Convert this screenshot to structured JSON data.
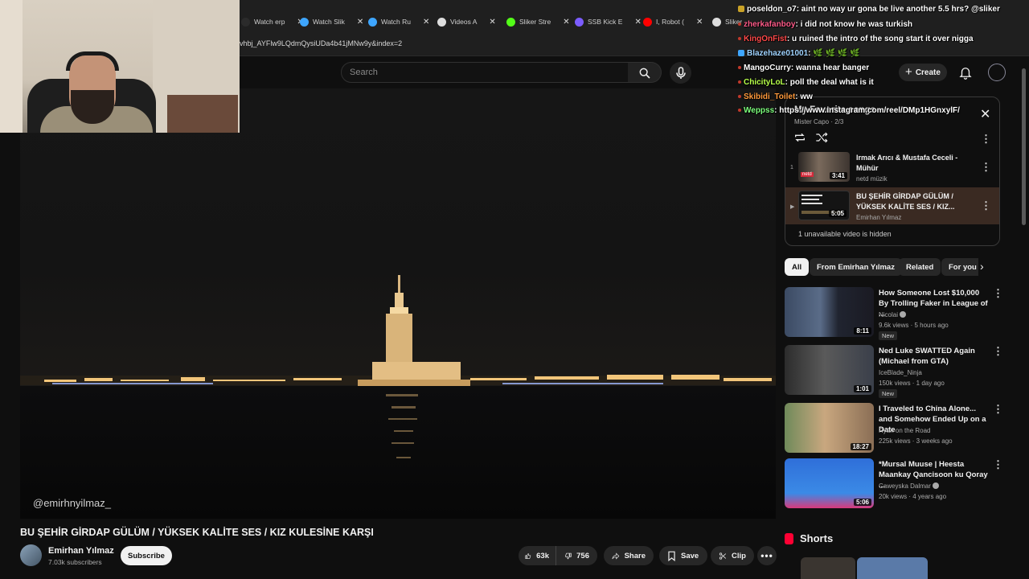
{
  "browser": {
    "tabs": [
      {
        "label": "Watch erp",
        "color": "#2b2b2b"
      },
      {
        "label": "Watch Slik",
        "color": "#3ea6ff"
      },
      {
        "label": "Watch Ru",
        "color": "#3ea6ff"
      },
      {
        "label": "Videos A",
        "color": "#dddddd"
      },
      {
        "label": "Sliker Stre",
        "color": "#53fc18"
      },
      {
        "label": "SSB Kick E",
        "color": "#7b5cff"
      },
      {
        "label": "I, Robot (",
        "color": "#ff0000"
      },
      {
        "label": "Sliker",
        "color": "#dddddd"
      }
    ],
    "url": "vhbj_AYFlw9LQdmQysiUDa4b41jMNw9y&index=2"
  },
  "search": {
    "placeholder": "Search"
  },
  "header": {
    "create_label": "Create"
  },
  "video": {
    "watermark": "@emirhnyilmaz_",
    "title": "BU ŞEHİR GİRDAP GÜLÜM / YÜKSEK KALİTE SES / KIZ KULESİNE KARŞI",
    "channel": "Emirhan Yılmaz",
    "subscribers": "7.03k subscribers",
    "subscribe_label": "Subscribe",
    "likes": "63k",
    "dislikes": "756",
    "share_label": "Share",
    "save_label": "Save",
    "clip_label": "Clip"
  },
  "playlist": {
    "title": "My Favorite songs",
    "subtitle": "Mister Capo · 2/3",
    "items": [
      {
        "index": "1",
        "title": "Irmak Arıcı & Mustafa Ceceli - Mühür",
        "channel": "netd müzik",
        "duration": "3:41"
      },
      {
        "index": "▶",
        "title": "BU ŞEHİR GİRDAP GÜLÜM / YÜKSEK KALİTE SES / KIZ...",
        "channel": "Emirhan Yılmaz",
        "duration": "5:05"
      }
    ],
    "hidden_note": "1 unavailable video is hidden"
  },
  "chips": [
    "All",
    "From Emirhan Yılmaz",
    "Related",
    "For you"
  ],
  "recommended": [
    {
      "title": "How Someone Lost $10,000 By Trolling Faker in League of ...",
      "channel": "Nicolai",
      "meta": "9.6k views · 5 hours ago",
      "badge": "New",
      "duration": "8:11"
    },
    {
      "title": "Ned Luke SWATTED Again (Michael from GTA)",
      "channel": "IceBlade_Ninja",
      "meta": "150k views · 1 day ago",
      "badge": "New",
      "duration": "1:01"
    },
    {
      "title": "I Traveled to China Alone... and Somehow Ended Up on a Date",
      "channel": "Ryan on the Road",
      "meta": "225k views · 3 weeks ago",
      "badge": "",
      "duration": "18:27"
    },
    {
      "title": "*Mursal Muuse | Heesta Maankay Qancisoon ku Qoray ...",
      "channel": "Caweyska Dalmar",
      "meta": "20k views · 4 years ago",
      "badge": "",
      "duration": "5:06"
    }
  ],
  "shorts_label": "Shorts",
  "chat": [
    {
      "user": "poseldon_o7",
      "color": "#ffffff",
      "badge": "#c9a227",
      "msg": ": aint no way ur gona be live another 5.5 hrs? @sliker"
    },
    {
      "user": "zherkafanboy",
      "color": "#ff5c8a",
      "badge": "",
      "msg": ": i did not know he was turkish"
    },
    {
      "user": "KingOnFist",
      "color": "#ff4a4a",
      "badge": "",
      "msg": ": u ruined the intro of the song start it over nigga"
    },
    {
      "user": "Blazehaze01001",
      "color": "#9fd3ff",
      "badge": "#3ea6ff",
      "msg": ": 🌿 🌿 🌿 🌿"
    },
    {
      "user": "MangoCurry",
      "color": "#ffffff",
      "badge": "",
      "msg": ": wanna hear banger"
    },
    {
      "user": "ChicityLoL",
      "color": "#b7ff4a",
      "badge": "",
      "msg": ": poll the deal what is it"
    },
    {
      "user": "Skibidi_Toilet",
      "color": "#ff9a3c",
      "badge": "",
      "msg": ": ww"
    },
    {
      "user": "Weppss",
      "color": "#7dff7d",
      "badge": "",
      "msg": ": https://www.instagram.com/reel/DMp1HGnxylF/"
    }
  ]
}
